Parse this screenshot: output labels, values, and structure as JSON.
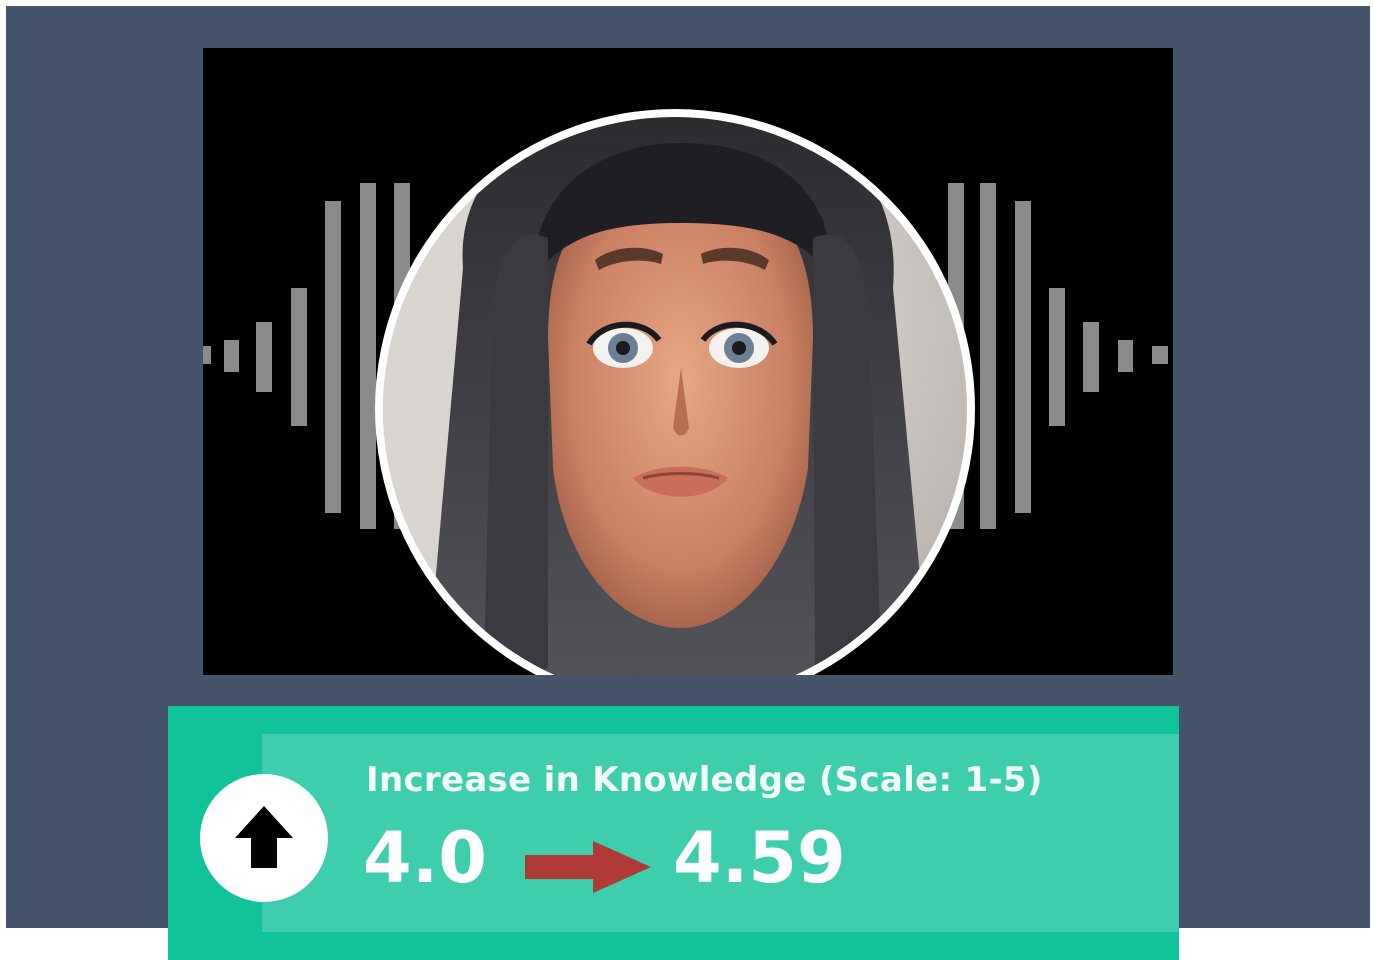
{
  "metric": {
    "label": "Increase in Knowledge (Scale: 1-5)",
    "before": "4.0",
    "after": "4.59"
  },
  "icons": {
    "badge": "arrow-up-icon",
    "change": "arrow-right-icon",
    "media": "audio-waveform-icon"
  },
  "colors": {
    "background": "#46546b",
    "panel": "#12c29a",
    "panel_inner": "#3fcead",
    "change_arrow": "#b03a35",
    "waveform": "#8a8a8a"
  }
}
